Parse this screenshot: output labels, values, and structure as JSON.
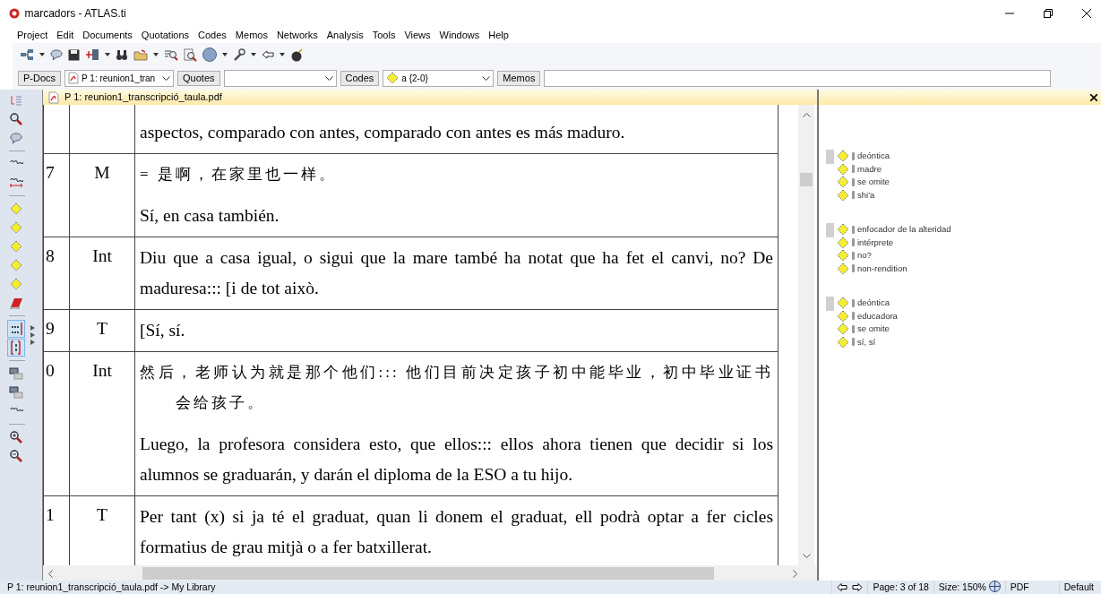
{
  "window": {
    "title": "marcadors - ATLAS.ti"
  },
  "menu": [
    "Project",
    "Edit",
    "Documents",
    "Quotations",
    "Codes",
    "Memos",
    "Networks",
    "Analysis",
    "Tools",
    "Views",
    "Windows",
    "Help"
  ],
  "selectors": [
    {
      "label": "P-Docs",
      "value": "P 1: reunion1_tran"
    },
    {
      "label": "Quotes"
    },
    {
      "label": "Codes",
      "value": "a {2-0}"
    },
    {
      "label": "Memos"
    }
  ],
  "side_tools": [
    {
      "kind": "list",
      "on": false
    },
    {
      "kind": "search",
      "on": false
    },
    {
      "kind": "bubble",
      "on": false
    },
    {
      "kind": "sep"
    },
    {
      "kind": "quote",
      "on": false
    },
    {
      "kind": "quote2",
      "on": false
    },
    {
      "kind": "sep"
    },
    {
      "kind": "code",
      "on": false
    },
    {
      "kind": "code",
      "on": false
    },
    {
      "kind": "code",
      "on": false
    },
    {
      "kind": "code",
      "on": false
    },
    {
      "kind": "code",
      "on": false
    },
    {
      "kind": "book",
      "on": false
    },
    {
      "kind": "sep"
    },
    {
      "kind": "numbers",
      "on": true
    },
    {
      "kind": "bracket",
      "on": true
    },
    {
      "kind": "sep"
    },
    {
      "kind": "panel",
      "on": false
    },
    {
      "kind": "panel",
      "on": false
    },
    {
      "kind": "quote",
      "on": false
    },
    {
      "kind": "sep"
    },
    {
      "kind": "zoomin",
      "on": false
    },
    {
      "kind": "zoomout",
      "on": false
    }
  ],
  "document": {
    "tab": "P 1: reunion1_transcripció_taula.pdf",
    "rows": [
      {
        "lines": [
          {
            "kind": "text",
            "text": "aspectos, comparado con antes, comparado con antes es más maduro."
          }
        ]
      },
      {
        "number": "7",
        "speaker": "M",
        "lines": [
          {
            "kind": "cjk",
            "text": "= 是啊，在家里也一样。"
          },
          {
            "kind": "text",
            "text": "Sí, en casa también."
          }
        ]
      },
      {
        "number": "8",
        "speaker": "Int",
        "lines": [
          {
            "kind": "text",
            "text": "Diu que a casa igual, o sigui que la mare també ha notat que ha fet el canvi, no? De maduresa::: [i de tot això."
          }
        ]
      },
      {
        "number": "9",
        "speaker": "T",
        "lines": [
          {
            "kind": "text",
            "text": "[Sí, sí."
          }
        ]
      },
      {
        "number": "0",
        "speaker": "Int",
        "lines": [
          {
            "kind": "cjk",
            "text": "然后，老师认为就是那个他们::: 他们目前决定孩子初中能毕业，初中毕业证书会给孩子。"
          },
          {
            "kind": "text",
            "text": "Luego, la profesora considera esto, que ellos::: ellos ahora tienen que decidir si los alumnos se graduarán, y darán el diploma de la ESO a tu hijo."
          }
        ]
      },
      {
        "number": "1",
        "speaker": "T",
        "lines": [
          {
            "kind": "text",
            "text": "Per tant (x) si ja té el graduat, quan li donem el graduat, ell podrà optar a fer cicles formatius de grau mitjà o a fer batxillerat."
          }
        ]
      }
    ]
  },
  "margin": [
    {
      "codes": [
        "deóntica",
        "madre",
        "se omite",
        "shi'a"
      ]
    },
    {
      "codes": [
        "enfocador de la alteridad",
        "intérprete",
        "no?",
        "non-rendition"
      ]
    },
    {
      "codes": [
        "deóntica",
        "educadora",
        "se omite",
        "sí, sí"
      ]
    }
  ],
  "status_bar": {
    "path": "P 1: reunion1_transcripció_taula.pdf -> My Library",
    "page": "Page: 3 of 18",
    "size": "Size: 150%",
    "format": "PDF",
    "mode": "Default"
  }
}
